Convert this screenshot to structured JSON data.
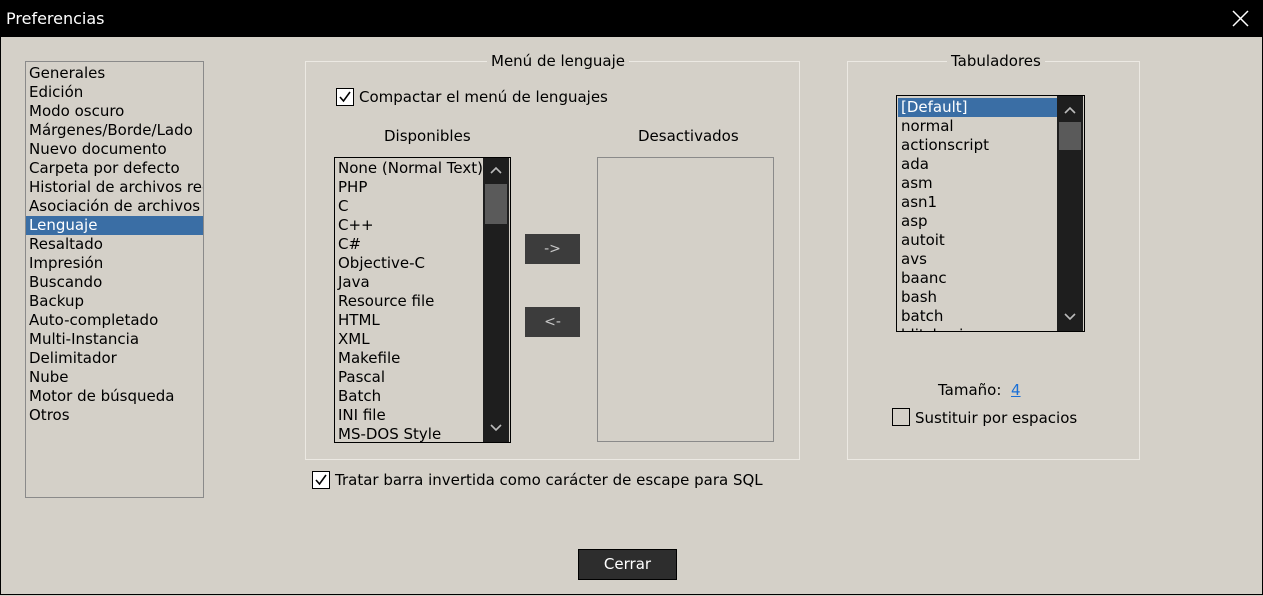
{
  "window": {
    "title": "Preferencias"
  },
  "sidebar": {
    "items": [
      {
        "label": "Generales"
      },
      {
        "label": "Edición"
      },
      {
        "label": "Modo oscuro"
      },
      {
        "label": "Márgenes/Borde/Lado"
      },
      {
        "label": "Nuevo documento"
      },
      {
        "label": "Carpeta por defecto"
      },
      {
        "label": "Historial de archivos reci"
      },
      {
        "label": "Asociación de archivos"
      },
      {
        "label": "Lenguaje"
      },
      {
        "label": "Resaltado"
      },
      {
        "label": "Impresión"
      },
      {
        "label": "Buscando"
      },
      {
        "label": "Backup"
      },
      {
        "label": "Auto-completado"
      },
      {
        "label": "Multi-Instancia"
      },
      {
        "label": "Delimitador"
      },
      {
        "label": "Nube"
      },
      {
        "label": "Motor de búsqueda"
      },
      {
        "label": "Otros"
      }
    ],
    "selected": "Lenguaje"
  },
  "language_menu": {
    "title": "Menú de lenguaje",
    "compact_label": "Compactar el menú de lenguajes",
    "compact_checked": true,
    "available_label": "Disponibles",
    "disabled_label": "Desactivados",
    "available": [
      "None (Normal Text)",
      "PHP",
      "C",
      "C++",
      "C#",
      "Objective-C",
      "Java",
      "Resource file",
      "HTML",
      "XML",
      "Makefile",
      "Pascal",
      "Batch",
      "INI file",
      "MS-DOS Style"
    ],
    "disabled": [],
    "move_right_label": "->",
    "move_left_label": "<-"
  },
  "tabs": {
    "title": "Tabuladores",
    "items": [
      "[Default]",
      "normal",
      "actionscript",
      "ada",
      "asm",
      "asn1",
      "asp",
      "autoit",
      "avs",
      "baanc",
      "bash",
      "batch",
      "blitzbasic"
    ],
    "selected": "[Default]",
    "size_label": "Tamaño:",
    "size_value": "4",
    "replace_label": "Sustituir por espacios",
    "replace_checked": false
  },
  "sql_escape": {
    "label": "Tratar barra invertida como carácter de escape para SQL",
    "checked": true
  },
  "footer": {
    "close_label": "Cerrar"
  },
  "colors": {
    "selection": "#3a6ea5",
    "background": "#d4d0c8",
    "link": "#1a6fd6"
  }
}
